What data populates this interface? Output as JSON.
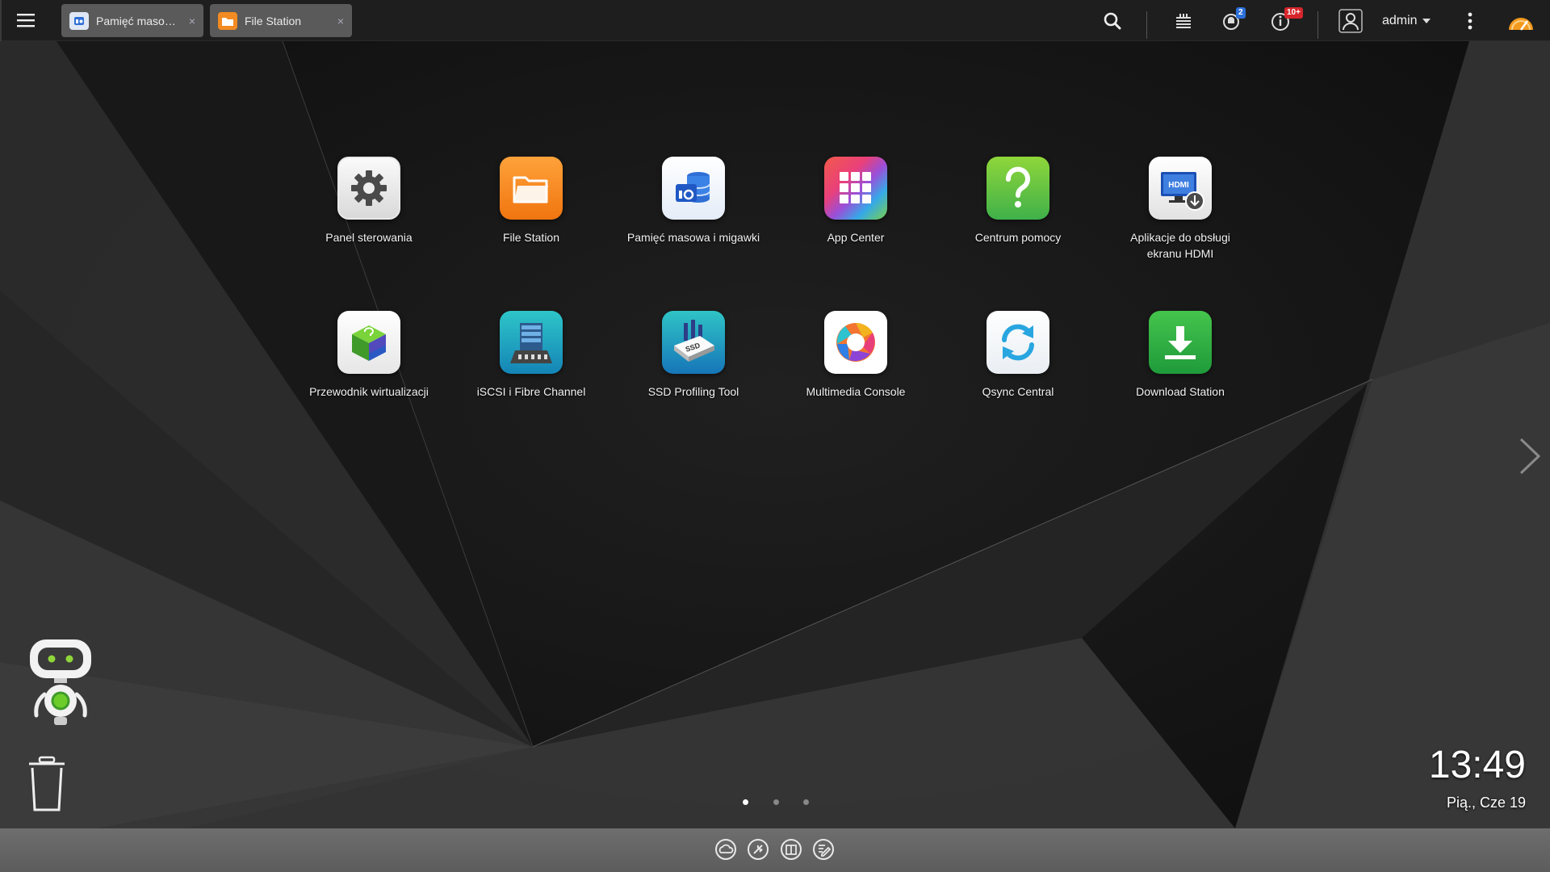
{
  "topbar": {
    "tabs": [
      {
        "label": "Pamięć masow…",
        "icon": "storage-icon",
        "close": "×"
      },
      {
        "label": "File Station",
        "icon": "folder-icon",
        "close": "×"
      }
    ],
    "user": "admin",
    "notifications_badge": "2",
    "events_badge": "10+",
    "icons": [
      "search-icon",
      "task-stack-icon",
      "notification-bell-icon",
      "info-icon",
      "user-icon",
      "more-icon",
      "dashboard-gauge-icon"
    ]
  },
  "apps": [
    {
      "label": "Panel sterowania",
      "icon": "gear-icon"
    },
    {
      "label": "File Station",
      "icon": "folder-icon"
    },
    {
      "label": "Pamięć masowa i migawki",
      "icon": "storage-icon"
    },
    {
      "label": "App Center",
      "icon": "app-grid-icon"
    },
    {
      "label": "Centrum pomocy",
      "icon": "question-icon"
    },
    {
      "label": "Aplikacje do obsługi ekranu HDMI",
      "icon": "hdmi-icon"
    },
    {
      "label": "Przewodnik wirtualizacji",
      "icon": "virtualization-cube-icon"
    },
    {
      "label": "iSCSI i Fibre Channel",
      "icon": "iscsi-icon"
    },
    {
      "label": "SSD Profiling Tool",
      "icon": "ssd-icon"
    },
    {
      "label": "Multimedia Console",
      "icon": "multimedia-icon"
    },
    {
      "label": "Qsync Central",
      "icon": "sync-icon"
    },
    {
      "label": "Download Station",
      "icon": "download-icon"
    }
  ],
  "clock": {
    "time": "13:49",
    "date": "Pią., Cze 19"
  },
  "pages": {
    "count": 3,
    "active": 1
  },
  "bottombar": {
    "icons": [
      "cloud-icon",
      "tools-icon",
      "book-icon",
      "edit-icon"
    ]
  },
  "colors": {
    "topbar": "#1e1e1e",
    "tab": "#5a5a5a",
    "bottombar": "#666666"
  }
}
